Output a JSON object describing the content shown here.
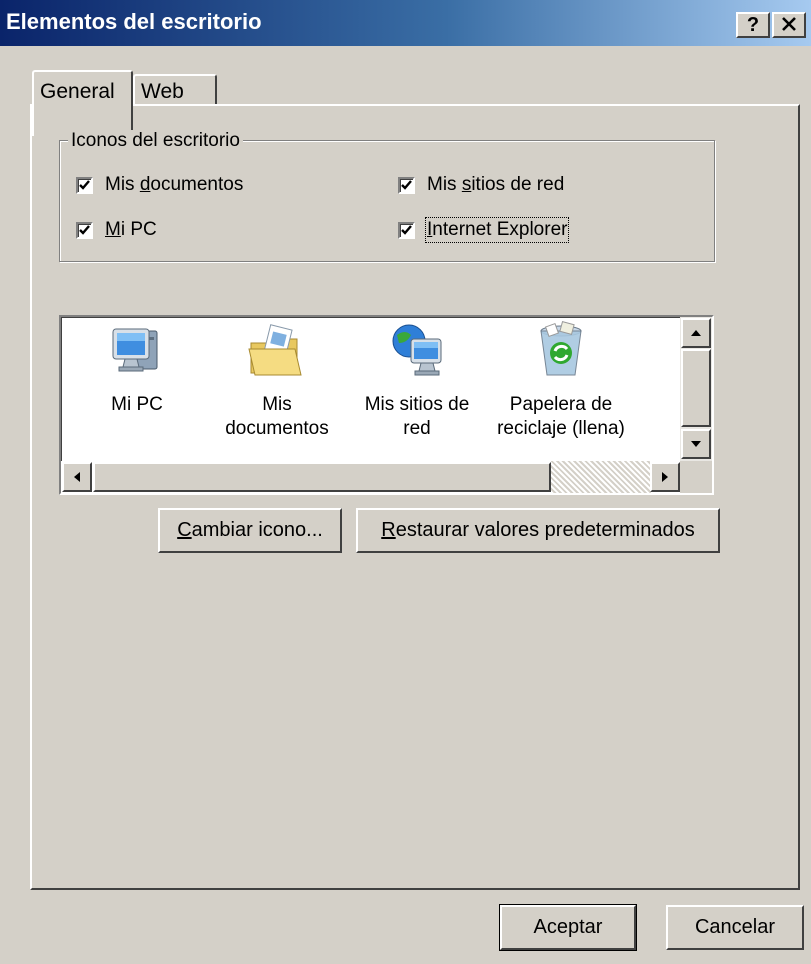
{
  "window": {
    "title": "Elementos del escritorio",
    "help_button": "?",
    "close_button": "×"
  },
  "tabs": [
    {
      "label": "General",
      "selected": true
    },
    {
      "label": "Web",
      "selected": false
    }
  ],
  "desktop_icons_group": {
    "legend": "Iconos del escritorio",
    "checkboxes": [
      {
        "label_pre": "Mis ",
        "label_key": "d",
        "label_post": "ocumentos",
        "checked": true
      },
      {
        "label_pre": "",
        "label_key": "M",
        "label_post": "i PC",
        "checked": true
      },
      {
        "label_pre": "Mis ",
        "label_key": "s",
        "label_post": "itios de red",
        "checked": true
      },
      {
        "label_pre": "",
        "label_key": "I",
        "label_post": "nternet Explorer",
        "checked": true,
        "focused": true
      }
    ]
  },
  "icon_list": {
    "items": [
      {
        "label_line1": "Mi PC",
        "label_line2": "",
        "icon": "computer-icon"
      },
      {
        "label_line1": "Mis",
        "label_line2": "documentos",
        "icon": "folder-documents-icon"
      },
      {
        "label_line1": "Mis sitios de",
        "label_line2": "red",
        "icon": "network-globe-icon"
      },
      {
        "label_line1": "Papelera de",
        "label_line2": "reciclaje (llena)",
        "icon": "recycle-bin-icon"
      }
    ]
  },
  "buttons": {
    "change_icon": {
      "key": "C",
      "rest": "ambiar icono..."
    },
    "restore_defaults": {
      "key": "R",
      "rest": "estaurar valores predeterminados"
    },
    "ok": "Aceptar",
    "cancel": "Cancelar"
  },
  "colors": {
    "face": "#d4d0c8",
    "title_start": "#0a246a",
    "title_end": "#a6caf0"
  }
}
